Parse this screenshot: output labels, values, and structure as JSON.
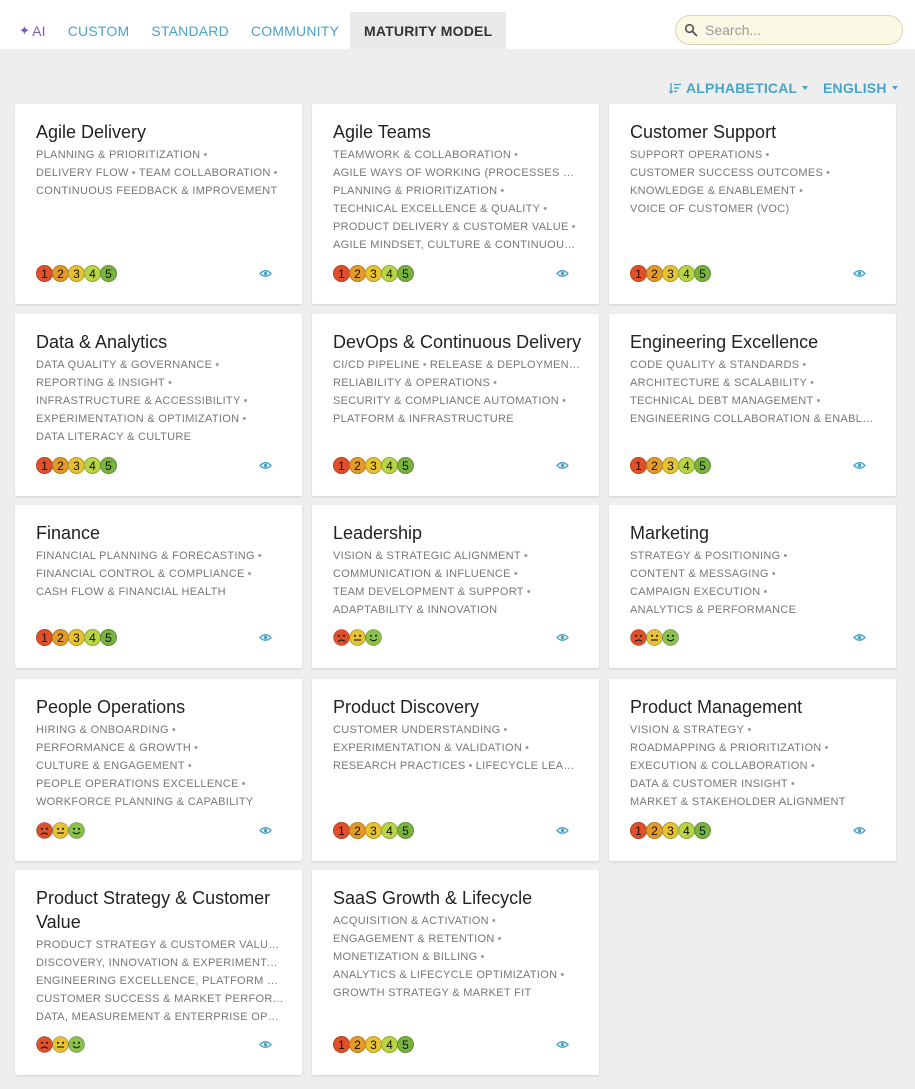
{
  "tabs": [
    {
      "label": "AI",
      "icon": "sparkle-icon",
      "active": false
    },
    {
      "label": "CUSTOM",
      "active": false
    },
    {
      "label": "STANDARD",
      "active": false
    },
    {
      "label": "COMMUNITY",
      "active": false
    },
    {
      "label": "MATURITY MODEL",
      "active": true
    }
  ],
  "search": {
    "placeholder": "Search...",
    "value": ""
  },
  "sort": {
    "label": "ALPHABETICAL",
    "icon": "sort-icon"
  },
  "language": {
    "label": "ENGLISH"
  },
  "colors": {
    "accent": "#4aa3c8",
    "level_1": "#e0502a",
    "level_2": "#e39a2a",
    "level_3": "#e7c233",
    "level_4": "#b9d445",
    "level_5": "#78b23f",
    "face_sad": "#e0502a",
    "face_neutral": "#e7c233",
    "face_happy": "#8bc34a"
  },
  "cards": [
    {
      "title": "Agile Delivery",
      "rating": "levels",
      "lines": [
        [
          "PLANNING & PRIORITIZATION"
        ],
        [
          "DELIVERY FLOW",
          "TEAM COLLABORATION"
        ],
        [
          "CONTINUOUS FEEDBACK & IMPROVEMENT"
        ]
      ]
    },
    {
      "title": "Agile Teams",
      "rating": "levels",
      "lines": [
        [
          "TEAMWORK & COLLABORATION"
        ],
        [
          "AGILE WAYS OF WORKING (PROCESSES & CERE"
        ],
        [
          "PLANNING & PRIORITIZATION"
        ],
        [
          "TECHNICAL EXCELLENCE & QUALITY"
        ],
        [
          "PRODUCT DELIVERY & CUSTOMER VALUE"
        ],
        [
          "AGILE MINDSET, CULTURE & CONTINUOUS IMPROVEMENT"
        ]
      ]
    },
    {
      "title": "Customer Support",
      "rating": "levels",
      "lines": [
        [
          "SUPPORT OPERATIONS"
        ],
        [
          "CUSTOMER SUCCESS OUTCOMES"
        ],
        [
          "KNOWLEDGE & ENABLEMENT"
        ],
        [
          "VOICE OF CUSTOMER (VOC)"
        ]
      ]
    },
    {
      "title": "Data & Analytics",
      "rating": "levels",
      "lines": [
        [
          "DATA QUALITY & GOVERNANCE"
        ],
        [
          "REPORTING & INSIGHT"
        ],
        [
          "INFRASTRUCTURE & ACCESSIBILITY"
        ],
        [
          "EXPERIMENTATION & OPTIMIZATION"
        ],
        [
          "DATA LITERACY & CULTURE"
        ]
      ]
    },
    {
      "title": "DevOps & Continuous Delivery",
      "rating": "levels",
      "lines": [
        [
          "CI/CD PIPELINE",
          "RELEASE & DEPLOYMENT"
        ],
        [
          "RELIABILITY & OPERATIONS"
        ],
        [
          "SECURITY & COMPLIANCE AUTOMATION"
        ],
        [
          "PLATFORM & INFRASTRUCTURE"
        ]
      ]
    },
    {
      "title": "Engineering Excellence",
      "rating": "levels",
      "lines": [
        [
          "CODE QUALITY & STANDARDS"
        ],
        [
          "ARCHITECTURE & SCALABILITY"
        ],
        [
          "TECHNICAL DEBT MANAGEMENT"
        ],
        [
          "ENGINEERING COLLABORATION & ENABLEMENT"
        ]
      ]
    },
    {
      "title": "Finance",
      "rating": "levels",
      "lines": [
        [
          "FINANCIAL PLANNING & FORECASTING"
        ],
        [
          "FINANCIAL CONTROL & COMPLIANCE"
        ],
        [
          "CASH FLOW & FINANCIAL HEALTH"
        ]
      ]
    },
    {
      "title": "Leadership",
      "rating": "faces",
      "lines": [
        [
          "VISION & STRATEGIC ALIGNMENT"
        ],
        [
          "COMMUNICATION & INFLUENCE"
        ],
        [
          "TEAM DEVELOPMENT & SUPPORT"
        ],
        [
          "ADAPTABILITY & INNOVATION"
        ]
      ]
    },
    {
      "title": "Marketing",
      "rating": "faces",
      "lines": [
        [
          "STRATEGY & POSITIONING"
        ],
        [
          "CONTENT & MESSAGING"
        ],
        [
          "CAMPAIGN EXECUTION"
        ],
        [
          "ANALYTICS & PERFORMANCE"
        ]
      ]
    },
    {
      "title": "People Operations",
      "rating": "faces",
      "lines": [
        [
          "HIRING & ONBOARDING"
        ],
        [
          "PERFORMANCE & GROWTH"
        ],
        [
          "CULTURE & ENGAGEMENT"
        ],
        [
          "PEOPLE OPERATIONS EXCELLENCE"
        ],
        [
          "WORKFORCE PLANNING & CAPABILITY"
        ]
      ]
    },
    {
      "title": "Product Discovery",
      "rating": "levels",
      "lines": [
        [
          "CUSTOMER UNDERSTANDING"
        ],
        [
          "EXPERIMENTATION & VALIDATION"
        ],
        [
          "RESEARCH PRACTICES",
          "LIFECYCLE LEARNING"
        ]
      ]
    },
    {
      "title": "Product Management",
      "rating": "levels",
      "lines": [
        [
          "VISION & STRATEGY"
        ],
        [
          "ROADMAPPING & PRIORITIZATION"
        ],
        [
          "EXECUTION & COLLABORATION"
        ],
        [
          "DATA & CUSTOMER INSIGHT"
        ],
        [
          "MARKET & STAKEHOLDER ALIGNMENT"
        ]
      ]
    },
    {
      "title": "Product Strategy & Customer Value",
      "rating": "faces",
      "lines": [
        [
          "PRODUCT STRATEGY & CUSTOMER VALUE"
        ],
        [
          "DISCOVERY, INNOVATION & EXPERIMENTATION"
        ],
        [
          "ENGINEERING EXCELLENCE, PLATFORM & DEVOPS"
        ],
        [
          "CUSTOMER SUCCESS & MARKET PERFORMANCE"
        ],
        [
          "DATA, MEASUREMENT & ENTERPRISE OPERATIONS"
        ]
      ]
    },
    {
      "title": "SaaS Growth & Lifecycle",
      "rating": "levels",
      "lines": [
        [
          "ACQUISITION & ACTIVATION"
        ],
        [
          "ENGAGEMENT & RETENTION"
        ],
        [
          "MONETIZATION & BILLING"
        ],
        [
          "ANALYTICS & LIFECYCLE OPTIMIZATION"
        ],
        [
          "GROWTH STRATEGY & MARKET FIT"
        ]
      ]
    }
  ]
}
